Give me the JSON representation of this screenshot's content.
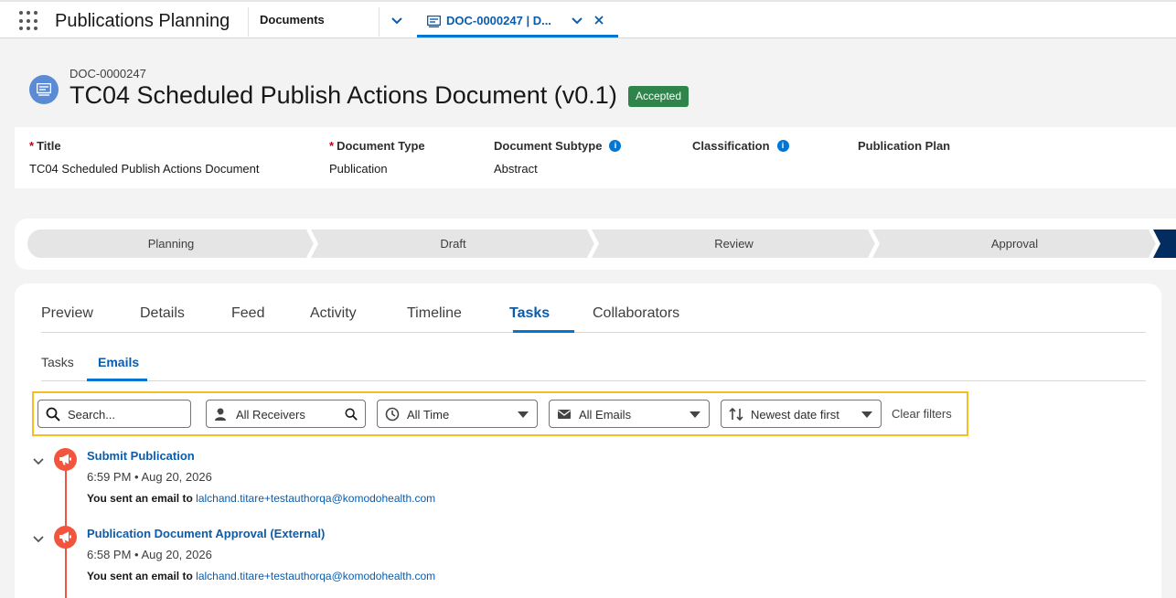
{
  "app": {
    "name": "Publications Planning"
  },
  "nav": {
    "documents_label": "Documents",
    "active_tab_label": "DOC-0000247 | D..."
  },
  "record": {
    "id": "DOC-0000247",
    "title": "TC04 Scheduled Publish Actions Document (v0.1)",
    "status": "Accepted"
  },
  "highlights": {
    "fields": [
      {
        "label": "Title",
        "required": true,
        "value": "TC04 Scheduled Publish Actions Document"
      },
      {
        "label": "Document Type",
        "required": true,
        "value": "Publication"
      },
      {
        "label": "Document Subtype",
        "required": false,
        "info": true,
        "value": "Abstract"
      },
      {
        "label": "Classification",
        "required": false,
        "info": true,
        "value": ""
      },
      {
        "label": "Publication Plan",
        "required": false,
        "value": ""
      }
    ]
  },
  "path": {
    "steps": [
      "Planning",
      "Draft",
      "Review",
      "Approval"
    ]
  },
  "tabs": {
    "items": [
      "Preview",
      "Details",
      "Feed",
      "Activity",
      "Timeline",
      "Tasks",
      "Collaborators"
    ],
    "active": "Tasks"
  },
  "subtabs": {
    "items": [
      "Tasks",
      "Emails"
    ],
    "active": "Emails"
  },
  "filters": {
    "search_placeholder": "Search...",
    "receivers": "All Receivers",
    "time": "All Time",
    "emails": "All Emails",
    "sort": "Newest date first",
    "clear": "Clear filters"
  },
  "timeline": [
    {
      "title": "Submit Publication",
      "time": "6:59 PM • Aug 20, 2026",
      "desc_prefix": "You sent an email to",
      "recipient": "lalchand.titare+testauthorqa@komodohealth.com"
    },
    {
      "title": "Publication Document Approval (External)",
      "time": "6:58 PM • Aug 20, 2026",
      "desc_prefix": "You sent an email to",
      "recipient": "lalchand.titare+testauthorqa@komodohealth.com"
    }
  ],
  "colors": {
    "brand_blue": "#0176d3",
    "accepted_green": "#2e844a",
    "email_orange": "#f2553d",
    "highlight_yellow": "#f4bc25"
  }
}
